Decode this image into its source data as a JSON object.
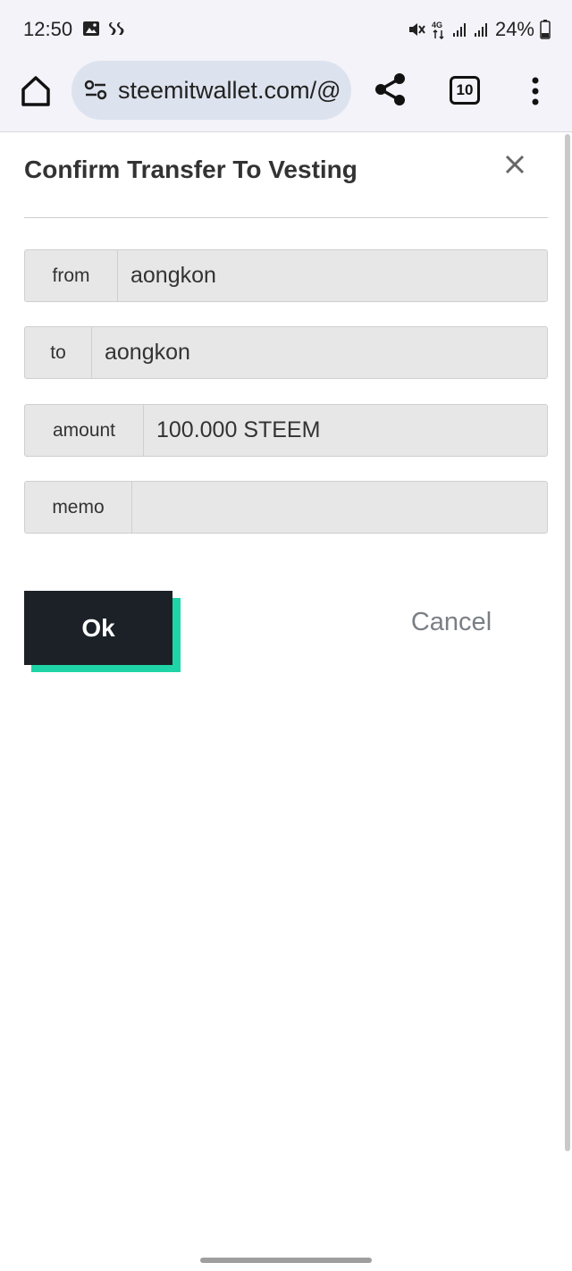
{
  "status_bar": {
    "time": "12:50",
    "battery": "24%",
    "network": "4G",
    "icons": [
      "gallery-icon",
      "steem-icon",
      "mute-icon",
      "network-icon",
      "signal-icon",
      "signal-icon",
      "battery-icon"
    ]
  },
  "browser": {
    "url": "steemitwallet.com/@",
    "tab_count": "10",
    "icons": [
      "home-icon",
      "site-settings-icon",
      "share-icon",
      "menu-icon"
    ]
  },
  "modal": {
    "title": "Confirm Transfer To Vesting",
    "fields": [
      {
        "label": "from",
        "value": "aongkon"
      },
      {
        "label": "to",
        "value": "aongkon"
      },
      {
        "label": "amount",
        "value": "100.000 STEEM"
      },
      {
        "label": "memo",
        "value": ""
      }
    ],
    "ok_label": "Ok",
    "cancel_label": "Cancel"
  },
  "colors": {
    "accent": "#1fd4a6",
    "button_dark": "#1b2126",
    "field_bg": "#e7e7e7"
  }
}
